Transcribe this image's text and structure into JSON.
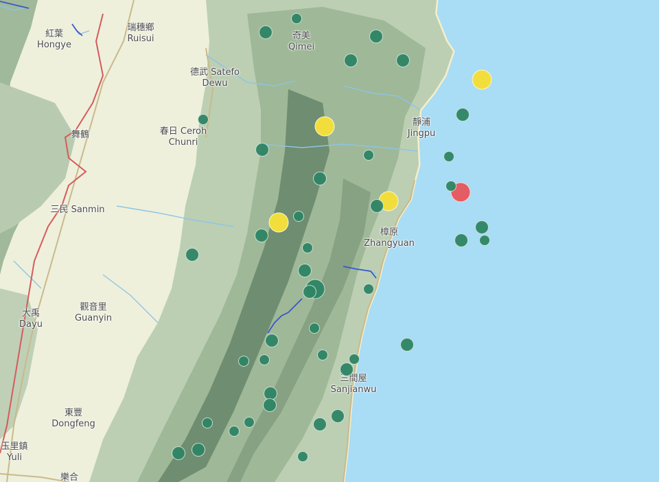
{
  "colors": {
    "sea": "#a9dcf5",
    "plain": "#eef0dc",
    "mountain_light": "#bdd0b4",
    "mountain_mid": "#92ae8d",
    "mountain_dark": "#5f7c62",
    "river": "#8cc5e6",
    "highway": "#d65a5a",
    "road": "#c9b98a",
    "marker_green": "#2f8564",
    "marker_yellow": "#f1de3c",
    "marker_red": "#e45d64"
  },
  "places": [
    {
      "id": "hongye",
      "zh": "紅葉",
      "en": "Hongye"
    },
    {
      "id": "ruisui",
      "zh": "瑞穗鄉",
      "en": "Ruisui"
    },
    {
      "id": "qimei",
      "zh": "奇美",
      "en": "Qimei"
    },
    {
      "id": "dewu",
      "zh": "德武 Satefo",
      "en": "Dewu"
    },
    {
      "id": "jingpu",
      "zh": "靜浦",
      "en": "Jingpu"
    },
    {
      "id": "wuhe",
      "zh": "舞鶴",
      "en": ""
    },
    {
      "id": "chunri",
      "zh": "春日 Ceroh",
      "en": "Chunri"
    },
    {
      "id": "sanmin",
      "zh": "三民 Sanmin",
      "en": ""
    },
    {
      "id": "zhangyuan",
      "zh": "樟原",
      "en": "Zhangyuan"
    },
    {
      "id": "guanyin",
      "zh": "觀音里",
      "en": "Guanyin"
    },
    {
      "id": "dayu",
      "zh": "大禹",
      "en": "Dayu"
    },
    {
      "id": "sanjianwu",
      "zh": "三間屋",
      "en": "Sanjianwu"
    },
    {
      "id": "dongfeng",
      "zh": "東豐",
      "en": "Dongfeng"
    },
    {
      "id": "yuli",
      "zh": "玉里鎮",
      "en": "Yuli"
    },
    {
      "id": "lehe",
      "zh": "樂合",
      "en": ""
    }
  ],
  "markers": [
    {
      "level": "strong",
      "size": "large"
    },
    {
      "level": "moderate",
      "size": "large"
    },
    {
      "level": "moderate",
      "size": "large"
    },
    {
      "level": "moderate",
      "size": "large"
    },
    {
      "level": "moderate",
      "size": "large"
    },
    {
      "level": "light",
      "size": "medium"
    },
    {
      "level": "light",
      "size": "medium"
    },
    {
      "level": "light",
      "size": "small"
    },
    {
      "level": "light",
      "size": "medium"
    },
    {
      "level": "light",
      "size": "medium"
    },
    {
      "level": "light",
      "size": "medium"
    },
    {
      "level": "light",
      "size": "small"
    },
    {
      "level": "light",
      "size": "medium"
    },
    {
      "level": "light",
      "size": "small"
    },
    {
      "level": "light",
      "size": "medium"
    },
    {
      "level": "light",
      "size": "small"
    },
    {
      "level": "light",
      "size": "small"
    },
    {
      "level": "light",
      "size": "medium"
    },
    {
      "level": "light",
      "size": "small"
    },
    {
      "level": "light",
      "size": "medium"
    },
    {
      "level": "light",
      "size": "small"
    },
    {
      "level": "light",
      "size": "medium"
    },
    {
      "level": "light",
      "size": "medium"
    },
    {
      "level": "light",
      "size": "small"
    },
    {
      "level": "light",
      "size": "medium"
    },
    {
      "level": "light",
      "size": "medium"
    },
    {
      "level": "light",
      "size": "large"
    },
    {
      "level": "light",
      "size": "medium"
    },
    {
      "level": "light",
      "size": "small"
    },
    {
      "level": "light",
      "size": "small"
    },
    {
      "level": "light",
      "size": "medium"
    },
    {
      "level": "light",
      "size": "medium"
    },
    {
      "level": "light",
      "size": "small"
    },
    {
      "level": "light",
      "size": "small"
    },
    {
      "level": "light",
      "size": "small"
    },
    {
      "level": "light",
      "size": "small"
    },
    {
      "level": "light",
      "size": "medium"
    },
    {
      "level": "light",
      "size": "medium"
    },
    {
      "level": "light",
      "size": "medium"
    },
    {
      "level": "light",
      "size": "small"
    },
    {
      "level": "light",
      "size": "small"
    },
    {
      "level": "light",
      "size": "small"
    },
    {
      "level": "light",
      "size": "medium"
    },
    {
      "level": "light",
      "size": "medium"
    },
    {
      "level": "light",
      "size": "medium"
    },
    {
      "level": "light",
      "size": "medium"
    },
    {
      "level": "light",
      "size": "small"
    }
  ]
}
